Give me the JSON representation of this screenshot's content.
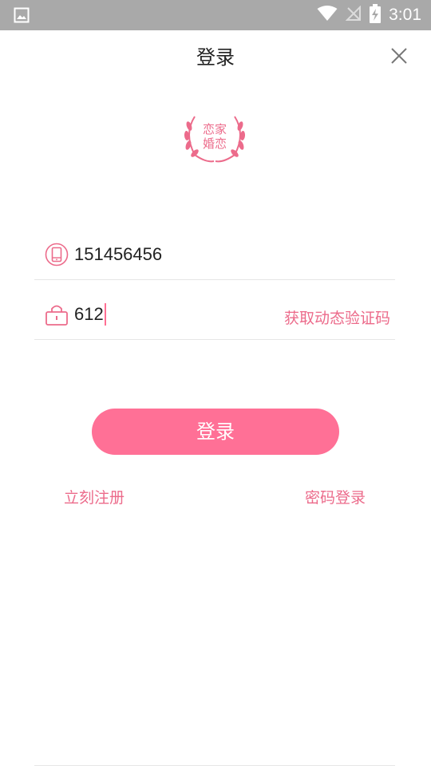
{
  "status_bar": {
    "time": "3:01",
    "icons": [
      "image-icon",
      "wifi-icon",
      "no-signal-icon",
      "battery-charging-icon"
    ]
  },
  "header": {
    "title": "登录",
    "close_icon": "close-icon"
  },
  "logo": {
    "line1": "恋家",
    "line2": "婚恋",
    "color": "#ec6b8b"
  },
  "form": {
    "phone_value": "151456456",
    "code_value": "612",
    "get_code_label": "获取动态验证码"
  },
  "actions": {
    "login_label": "登录",
    "register_label": "立刻注册",
    "password_login_label": "密码登录"
  },
  "colors": {
    "accent": "#ff7096",
    "link": "#ec6b8b",
    "status_bar": "#a9a9a9"
  }
}
